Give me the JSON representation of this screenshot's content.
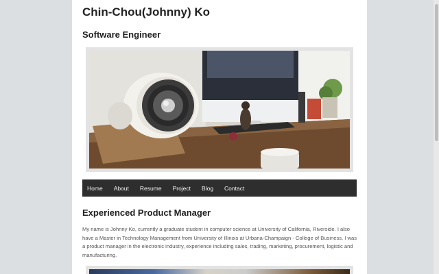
{
  "header": {
    "title": "Chin-Chou(Johnny) Ko",
    "subtitle": "Software Engineer"
  },
  "nav": {
    "items": [
      "Home",
      "About",
      "Resume",
      "Project",
      "Blog",
      "Contact"
    ]
  },
  "main": {
    "section_title": "Experienced Product Manager",
    "intro": "My name is Johnny Ko, currently a graduate student in computer science at University of California, Riverside. I also have a Master in Technology Management from University of Illinois at Urbana-Champaign - College of Business. I was a product manager in the electronic industry, experience including sales, trading, marketing, procurement, logistic and manufacturing."
  },
  "colors": {
    "page_background": "#dcdfe2",
    "content_background": "#ffffff",
    "nav_background": "#2e2e2e"
  }
}
